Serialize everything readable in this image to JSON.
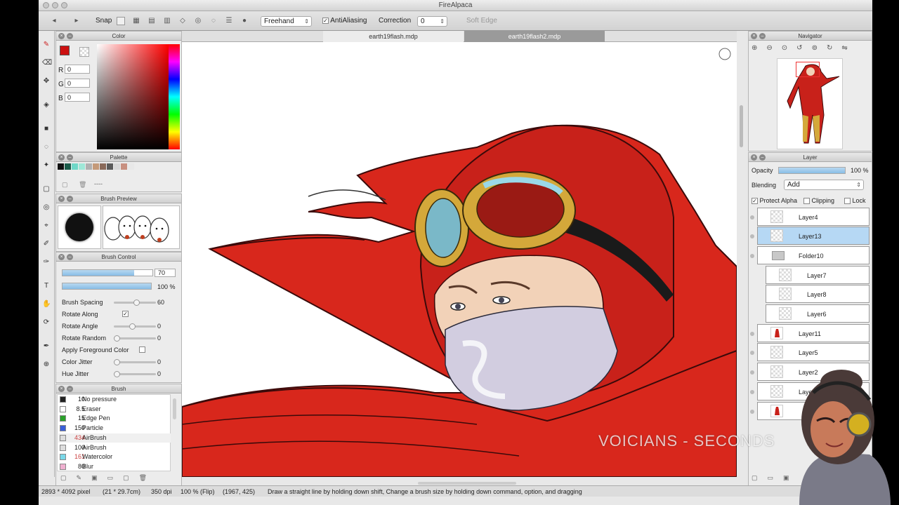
{
  "window": {
    "title": "FireAlpaca"
  },
  "toolbar": {
    "snap_label": "Snap",
    "mode_value": "Freehand",
    "antialiasing_label": "AntiAliasing",
    "antialiasing_checked": true,
    "correction_label": "Correction",
    "correction_value": "0",
    "soft_edge_label": "Soft Edge"
  },
  "tabs": [
    {
      "label": "earth19flash.mdp",
      "active": true
    },
    {
      "label": "earth19flash2.mdp",
      "active": false
    }
  ],
  "color_panel": {
    "title": "Color",
    "r_label": "R",
    "r_value": "0",
    "g_label": "G",
    "g_value": "0",
    "b_label": "B",
    "b_value": "0",
    "primary_color": "#cc1111"
  },
  "palette_panel": {
    "title": "Palette",
    "swatches": [
      "#111111",
      "#1a5c4a",
      "#6fd8c8",
      "#9fe8d8",
      "#b0b0b0",
      "#c49a7a",
      "#8a6a5a",
      "#5a5a5a",
      "#d8d8d8",
      "#c89080",
      "#e8e8e8"
    ],
    "dashes": "----"
  },
  "brush_preview": {
    "title": "Brush Preview"
  },
  "brush_control": {
    "title": "Brush Control",
    "size_value": "70",
    "opacity_value": "100 %",
    "rows": [
      {
        "label": "Brush Spacing",
        "value": "60"
      },
      {
        "label": "Rotate Along",
        "value": ""
      },
      {
        "label": "Rotate Angle",
        "value": "0"
      },
      {
        "label": "Rotate Random",
        "value": "0"
      },
      {
        "label": "Apply Foreground Color",
        "value": ""
      },
      {
        "label": "Color Jitter",
        "value": "0"
      },
      {
        "label": "Hue Jitter",
        "value": "0"
      }
    ]
  },
  "brush_panel": {
    "title": "Brush",
    "items": [
      {
        "size": "10",
        "name": "No pressure",
        "color": "#222222"
      },
      {
        "size": "8.5",
        "name": "Eraser",
        "color": "#ffffff"
      },
      {
        "size": "15",
        "name": "Edge Pen",
        "color": "#2aa02a"
      },
      {
        "size": "150",
        "name": "Particle",
        "color": "#3a5fd8"
      },
      {
        "size": "434",
        "name": "AirBrush",
        "color": "#dddddd"
      },
      {
        "size": "100",
        "name": "AirBrush",
        "color": "#dddddd"
      },
      {
        "size": "161",
        "name": "Watercolor",
        "color": "#7ad8e8"
      },
      {
        "size": "80",
        "name": "Blur",
        "color": "#f0b0d0"
      }
    ]
  },
  "navigator": {
    "title": "Navigator"
  },
  "layer_panel": {
    "title": "Layer",
    "opacity_label": "Opacity",
    "opacity_value": "100 %",
    "blending_label": "Blending",
    "blending_value": "Add",
    "protect_alpha_label": "Protect Alpha",
    "clipping_label": "Clipping",
    "lock_label": "Lock",
    "layers": [
      {
        "name": "Layer4"
      },
      {
        "name": "Layer13"
      },
      {
        "name": "Folder10"
      },
      {
        "name": "Layer7"
      },
      {
        "name": "Layer8"
      },
      {
        "name": "Layer6"
      },
      {
        "name": "Layer11"
      },
      {
        "name": "Layer5"
      },
      {
        "name": "Layer2"
      },
      {
        "name": "Layer3"
      }
    ]
  },
  "watermark": "VOICIANS - SECONDS",
  "status": {
    "dimensions": "2893 * 4092 pixel",
    "physical": "(21 * 29.7cm)",
    "dpi": "350 dpi",
    "zoom": "100 % (Flip)",
    "coords": "(1967, 425)",
    "hint": "Draw a straight line by holding down shift, Change a brush size by holding down command, option, and dragging"
  }
}
